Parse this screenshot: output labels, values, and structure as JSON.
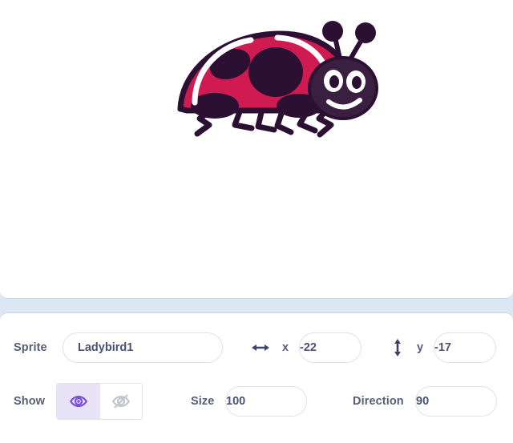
{
  "stage": {
    "background_color": "#ffffff",
    "sprite": {
      "name": "Ladybird1",
      "icon_name": "ladybird-sprite",
      "shell_color": "#cf1a52",
      "spot_color": "#2c1033",
      "outline_color": "#2c1033",
      "highlight_color": "#ffffff",
      "eye_color": "#ffffff"
    }
  },
  "divider": {
    "color": "#dce7f3"
  },
  "sprite_info": {
    "sprite_label": "Sprite",
    "sprite_name_value": "Ladybird1",
    "sprite_name_placeholder": "Sprite name",
    "x_label": "x",
    "x_value": "-22",
    "x_icon_name": "horizontal-arrows-icon",
    "y_label": "y",
    "y_value": "-17",
    "y_icon_name": "vertical-arrows-icon",
    "show_label": "Show",
    "show_visible_icon_name": "eye-icon",
    "show_hidden_icon_name": "eye-crossed-icon",
    "show_selected": "visible",
    "size_label": "Size",
    "size_value": "100",
    "direction_label": "Direction",
    "direction_value": "90",
    "accent_color": "#855cd6",
    "accent_background_color": "#e9e3f7",
    "label_color": "#575e75",
    "input_text_color": "#4a5173",
    "input_border_color": "#dfe2e8"
  }
}
